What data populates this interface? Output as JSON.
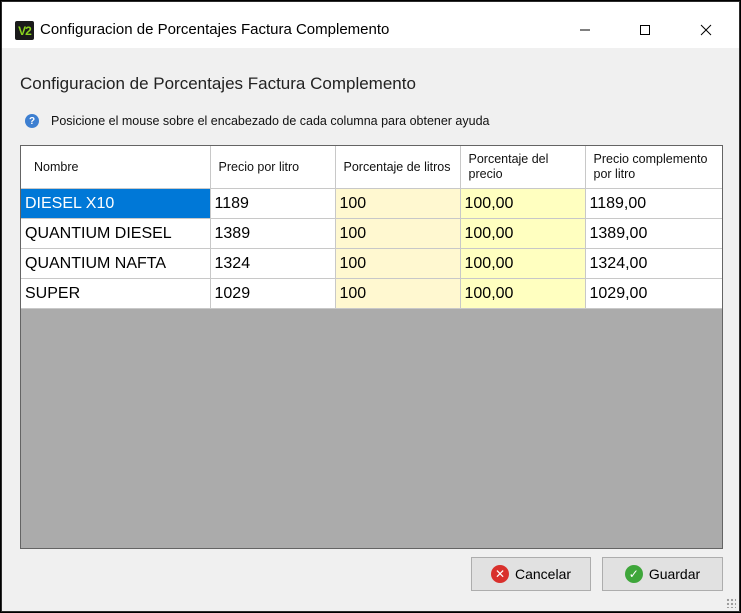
{
  "window": {
    "title": "Configuracion de Porcentajes Factura Complemento",
    "icon_label": "V2",
    "controls": [
      "minimize-icon",
      "maximize-icon",
      "close-icon"
    ]
  },
  "heading": "Configuracion de Porcentajes Factura Complemento",
  "help": {
    "icon": "question-icon",
    "text": "Posicione el mouse sobre el encabezado de cada columna para obtener ayuda"
  },
  "grid": {
    "columns": [
      "Nombre",
      "Precio por litro",
      "Porcentaje de litros",
      "Porcentaje del precio",
      "Precio complemento por litro"
    ],
    "rows": [
      [
        "DIESEL X10",
        "1189",
        "100",
        "100,00",
        "1189,00"
      ],
      [
        "QUANTIUM DIESEL",
        "1389",
        "100",
        "100,00",
        "1389,00"
      ],
      [
        "QUANTIUM NAFTA",
        "1324",
        "100",
        "100,00",
        "1324,00"
      ],
      [
        "SUPER",
        "1029",
        "100",
        "100,00",
        "1029,00"
      ]
    ],
    "selected_cell": "DIESEL X10"
  },
  "buttons": {
    "cancel": {
      "label": "Cancelar",
      "icon": "cancel-x-icon",
      "color": "#d9302c"
    },
    "save": {
      "label": "Guardar",
      "icon": "check-icon",
      "color": "#3ea63a"
    }
  },
  "colors": {
    "selection": "#0078d7",
    "editable_litros": "#fff8d0",
    "editable_precio": "#ffffc0",
    "grid_background": "#ababab"
  }
}
